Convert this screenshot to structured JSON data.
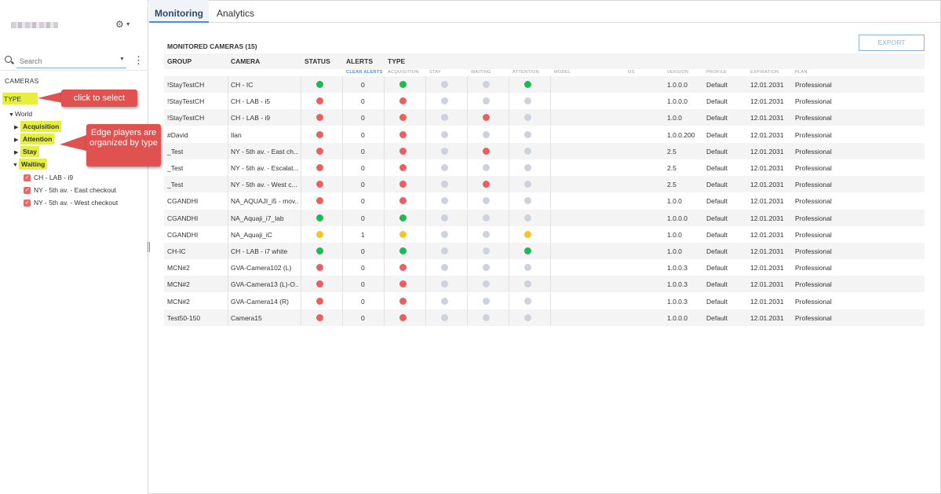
{
  "sidebar": {
    "search_placeholder": "Search",
    "cameras_label": "CAMERAS",
    "type_label": "TYPE",
    "tree": {
      "root": "World",
      "groups": [
        "Acquisition",
        "Attention",
        "Stay",
        "Waiting"
      ],
      "waiting_items": [
        "CH - LAB - i9",
        "NY - 5th av. - East checkout",
        "NY - 5th av. - West checkout"
      ]
    },
    "callouts": {
      "select": "click to select",
      "organized": "Edge players are organized by type"
    }
  },
  "tabs": [
    {
      "label": "Monitoring"
    },
    {
      "label": "Analytics"
    }
  ],
  "main": {
    "title": "MONITORED CAMERAS (15)",
    "export_label": "EXPORT",
    "headers": [
      "GROUP",
      "CAMERA",
      "STATUS",
      "ALERTS",
      "TYPE"
    ],
    "subheaders": [
      "CLEAR ALERTS",
      "ACQUISITION",
      "STAY",
      "WAITING",
      "ATTENTION",
      "MODEL",
      "OS",
      "VERSION",
      "PROFILE",
      "EXPIRATION",
      "PLAN"
    ],
    "colors": {
      "green": "#1db954",
      "red": "#ea6060",
      "yellow": "#f7c22c",
      "gray": "#ccd3dc"
    },
    "rows": [
      {
        "group": "!StayTestCH",
        "camera": "CH - IC",
        "status": "green",
        "alerts": "0",
        "acq": "green",
        "stay": "gray",
        "waiting": "gray",
        "attention": "green",
        "version": "1.0.0.0",
        "profile": "Default",
        "expiration": "12.01.2031",
        "plan": "Professional"
      },
      {
        "group": "!StayTestCH",
        "camera": "CH - LAB - i5",
        "status": "red",
        "alerts": "0",
        "acq": "red",
        "stay": "gray",
        "waiting": "gray",
        "attention": "gray",
        "version": "1.0.0.0",
        "profile": "Default",
        "expiration": "12.01.2031",
        "plan": "Professional"
      },
      {
        "group": "!StayTestCH",
        "camera": "CH - LAB - i9",
        "status": "red",
        "alerts": "0",
        "acq": "red",
        "stay": "gray",
        "waiting": "red",
        "attention": "gray",
        "version": "1.0.0",
        "profile": "Default",
        "expiration": "12.01.2031",
        "plan": "Professional"
      },
      {
        "group": "#David",
        "camera": "Ilan",
        "status": "red",
        "alerts": "0",
        "acq": "red",
        "stay": "gray",
        "waiting": "gray",
        "attention": "gray",
        "version": "1.0.0.200",
        "profile": "Default",
        "expiration": "12.01.2031",
        "plan": "Professional"
      },
      {
        "group": "_Test",
        "camera": "NY - 5th av. - East ch...",
        "status": "red",
        "alerts": "0",
        "acq": "red",
        "stay": "gray",
        "waiting": "red",
        "attention": "gray",
        "version": "2.5",
        "profile": "Default",
        "expiration": "12.01.2031",
        "plan": "Professional"
      },
      {
        "group": "_Test",
        "camera": "NY - 5th av. - Escalat...",
        "status": "red",
        "alerts": "0",
        "acq": "red",
        "stay": "gray",
        "waiting": "gray",
        "attention": "gray",
        "version": "2.5",
        "profile": "Default",
        "expiration": "12.01.2031",
        "plan": "Professional"
      },
      {
        "group": "_Test",
        "camera": "NY - 5th av. - West c...",
        "status": "red",
        "alerts": "0",
        "acq": "red",
        "stay": "gray",
        "waiting": "red",
        "attention": "gray",
        "version": "2.5",
        "profile": "Default",
        "expiration": "12.01.2031",
        "plan": "Professional"
      },
      {
        "group": "CGANDHI",
        "camera": "NA_AQUAJI_i5 - mov...",
        "status": "red",
        "alerts": "0",
        "acq": "red",
        "stay": "gray",
        "waiting": "gray",
        "attention": "gray",
        "version": "1.0.0",
        "profile": "Default",
        "expiration": "12.01.2031",
        "plan": "Professional"
      },
      {
        "group": "CGANDHI",
        "camera": "NA_Aquaji_i7_lab",
        "status": "green",
        "alerts": "0",
        "acq": "green",
        "stay": "gray",
        "waiting": "gray",
        "attention": "gray",
        "version": "1.0.0.0",
        "profile": "Default",
        "expiration": "12.01.2031",
        "plan": "Professional"
      },
      {
        "group": "CGANDHI",
        "camera": "NA_Aquaji_iC",
        "status": "yellow",
        "alerts": "1",
        "acq": "yellow",
        "stay": "gray",
        "waiting": "gray",
        "attention": "yellow",
        "version": "1.0.0",
        "profile": "Default",
        "expiration": "12.01.2031",
        "plan": "Professional"
      },
      {
        "group": "CH-IC",
        "camera": "CH - LAB - i7 white",
        "status": "green",
        "alerts": "0",
        "acq": "green",
        "stay": "gray",
        "waiting": "gray",
        "attention": "green",
        "version": "1.0.0",
        "profile": "Default",
        "expiration": "12.01.2031",
        "plan": "Professional"
      },
      {
        "group": "MCN#2",
        "camera": "GVA-Camera102 (L)",
        "status": "red",
        "alerts": "0",
        "acq": "red",
        "stay": "gray",
        "waiting": "gray",
        "attention": "gray",
        "version": "1.0.0.3",
        "profile": "Default",
        "expiration": "12.01.2031",
        "plan": "Professional"
      },
      {
        "group": "MCN#2",
        "camera": "GVA-Camera13 (L)-O...",
        "status": "red",
        "alerts": "0",
        "acq": "red",
        "stay": "gray",
        "waiting": "gray",
        "attention": "gray",
        "version": "1.0.0.3",
        "profile": "Default",
        "expiration": "12.01.2031",
        "plan": "Professional"
      },
      {
        "group": "MCN#2",
        "camera": "GVA-Camera14 (R)",
        "status": "red",
        "alerts": "0",
        "acq": "red",
        "stay": "gray",
        "waiting": "gray",
        "attention": "gray",
        "version": "1.0.0.3",
        "profile": "Default",
        "expiration": "12.01.2031",
        "plan": "Professional"
      },
      {
        "group": "Test50-150",
        "camera": "Camera15",
        "status": "red",
        "alerts": "0",
        "acq": "red",
        "stay": "gray",
        "waiting": "gray",
        "attention": "gray",
        "version": "1.0.0.0",
        "profile": "Default",
        "expiration": "12.01.2031",
        "plan": "Professional"
      }
    ]
  }
}
